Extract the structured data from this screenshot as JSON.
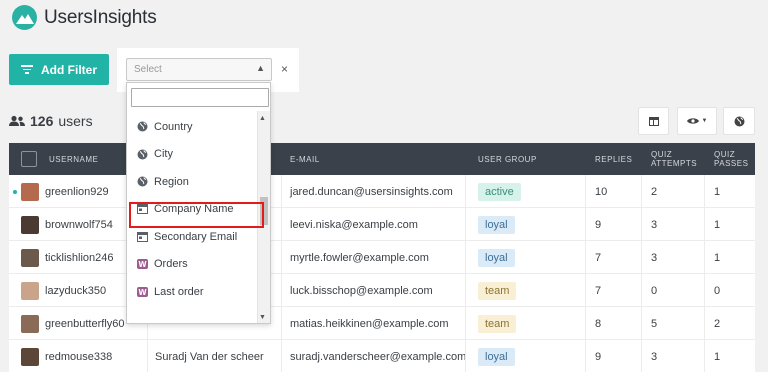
{
  "brand": {
    "name": "UsersInsights",
    "color": "#2bb0a4"
  },
  "toolbar": {
    "add_filter_label": "Add Filter",
    "accent": "#21b3a6"
  },
  "filter": {
    "select_placeholder": "Select",
    "close_label": "×",
    "dropdown": {
      "search_value": "",
      "highlighted_item": "Company Name",
      "items": [
        {
          "label": "Country",
          "icon": "globe-icon"
        },
        {
          "label": "City",
          "icon": "globe-icon"
        },
        {
          "label": "Region",
          "icon": "globe-icon"
        },
        {
          "label": "Company Name",
          "icon": "card-icon"
        },
        {
          "label": "Secondary Email",
          "icon": "card-icon"
        },
        {
          "label": "Orders",
          "icon": "woo-icon"
        },
        {
          "label": "Last order",
          "icon": "woo-icon"
        }
      ]
    }
  },
  "summary": {
    "count": "126",
    "unit": "users"
  },
  "table": {
    "headers": {
      "username": "USERNAME",
      "email": "E-MAIL",
      "user_group": "USER GROUP",
      "replies": "REPLIES",
      "quiz_attempts": "QUIZ ATTEMPTS",
      "quiz_passes": "QUIZ PASSES"
    },
    "rows": [
      {
        "username": "greenlion929",
        "name": "",
        "email": "jared.duncan@usersinsights.com",
        "group": "active",
        "replies": "10",
        "attempts": "2",
        "passes": "1"
      },
      {
        "username": "brownwolf754",
        "name": "",
        "email": "leevi.niska@example.com",
        "group": "loyal",
        "replies": "9",
        "attempts": "3",
        "passes": "1"
      },
      {
        "username": "ticklishlion246",
        "name": "",
        "email": "myrtle.fowler@example.com",
        "group": "loyal",
        "replies": "7",
        "attempts": "3",
        "passes": "1"
      },
      {
        "username": "lazyduck350",
        "name": "",
        "email": "luck.bisschop@example.com",
        "group": "team",
        "replies": "7",
        "attempts": "0",
        "passes": "0"
      },
      {
        "username": "greenbutterfly60",
        "name": "",
        "email": "matias.heikkinen@example.com",
        "group": "team",
        "replies": "8",
        "attempts": "5",
        "passes": "2"
      },
      {
        "username": "redmouse338",
        "name": "Suradj Van der scheer",
        "email": "suradj.vanderscheer@example.com",
        "group": "loyal",
        "replies": "9",
        "attempts": "3",
        "passes": "1"
      }
    ]
  },
  "group_colors": {
    "active": {
      "bg": "#d6f2ea",
      "fg": "#3a8f78"
    },
    "loyal": {
      "bg": "#dbeaf7",
      "fg": "#3c6f9a"
    },
    "team": {
      "bg": "#f9efd4",
      "fg": "#8d7433"
    }
  }
}
